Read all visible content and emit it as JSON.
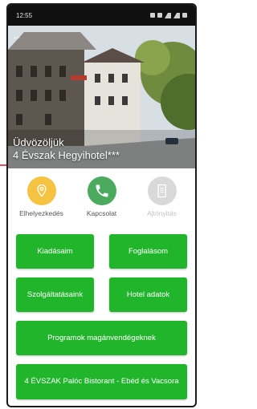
{
  "status_bar": {
    "time": "12:55"
  },
  "hero": {
    "welcome": "Üdvözöljük",
    "hotel_name": "4 Évszak Hegyihotel***",
    "back_glyph": "←"
  },
  "actions": [
    {
      "label": "Elhelyezkedés",
      "icon": "location-pin-icon",
      "color": "#f5c242"
    },
    {
      "label": "Kapcsolat",
      "icon": "phone-icon",
      "color": "#4caa5f"
    },
    {
      "label": "Ajtónyitás",
      "icon": "door-icon",
      "color": "#d9d9d9"
    }
  ],
  "buttons": {
    "expenses": "Kiadásaim",
    "booking": "Foglalásom",
    "services": "Szolgáltatásaink",
    "hotel_info": "Hotel adatok",
    "programs": "Programok magánvendégeknek",
    "bistro": "4 ÉVSZAK Palóc Bistorant - Ebéd és Vacsora"
  },
  "colors": {
    "accent_green": "#20b52b",
    "annotation_arrow": "#e0112b"
  }
}
